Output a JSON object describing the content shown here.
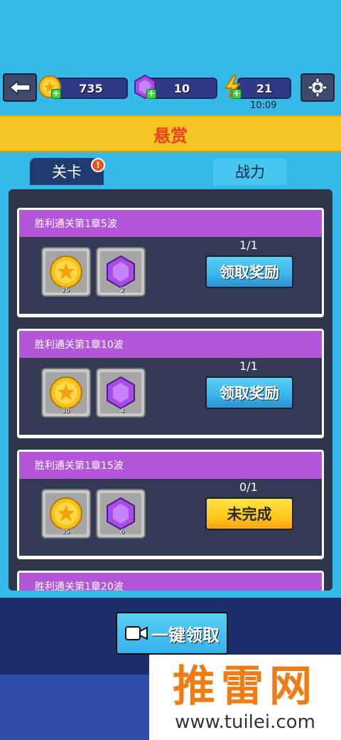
{
  "header": {
    "back_icon": "arrow-left-icon",
    "coins": "735",
    "gems": "10",
    "energy": "21",
    "energy_timer": "10:09",
    "settings_icon": "gear-icon"
  },
  "title": "悬赏",
  "tabs": [
    {
      "label": "关卡",
      "active": true,
      "alert": "!"
    },
    {
      "label": "战力",
      "active": false
    }
  ],
  "quests": [
    {
      "title": "胜利通关第1章5波",
      "rewards": [
        {
          "icon": "coin-icon",
          "qty": "25"
        },
        {
          "icon": "gem-icon",
          "qty": "2"
        }
      ],
      "progress": "1/1",
      "button": "领取奖励",
      "state": "claimable"
    },
    {
      "title": "胜利通关第1章10波",
      "rewards": [
        {
          "icon": "coin-icon",
          "qty": "30"
        },
        {
          "icon": "gem-icon",
          "qty": "4"
        }
      ],
      "progress": "1/1",
      "button": "领取奖励",
      "state": "claimable"
    },
    {
      "title": "胜利通关第1章15波",
      "rewards": [
        {
          "icon": "coin-icon",
          "qty": "35"
        },
        {
          "icon": "gem-icon",
          "qty": "6"
        }
      ],
      "progress": "0/1",
      "button": "未完成",
      "state": "incomplete"
    },
    {
      "title": "胜利通关第1章20波"
    }
  ],
  "claim_all": {
    "label": "一键领取",
    "icon": "video-icon"
  },
  "watermark": {
    "main": "推雷网",
    "sub": "www.tuilei.com"
  },
  "colors": {
    "background": "#35b9e8",
    "title_band": "#f4c425",
    "title_text": "#e6431f",
    "card_header": "#b356da",
    "button_blue": "#3ab4ec",
    "button_yellow": "#ffcb19"
  }
}
